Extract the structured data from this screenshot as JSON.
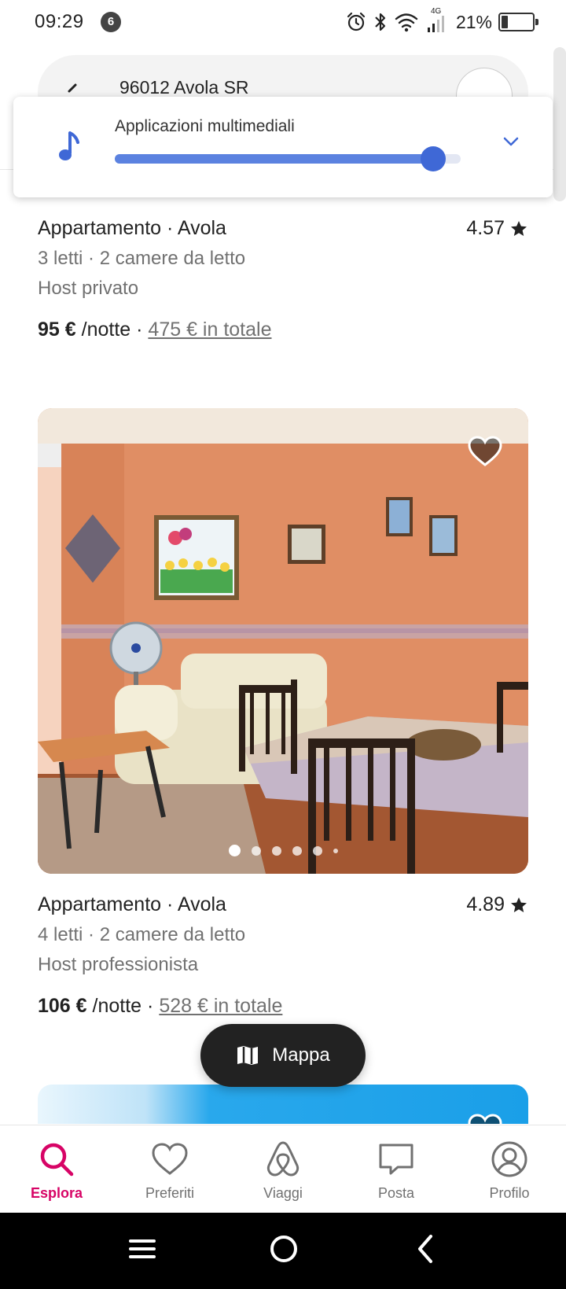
{
  "status_bar": {
    "time": "09:29",
    "notification_count": "6",
    "network_label": "4G",
    "battery_percent": "21%"
  },
  "search": {
    "location": "96012 Avola SR"
  },
  "volume_panel": {
    "label": "Applicazioni multimediali",
    "level": 0.92,
    "accent_color": "#3f68d6"
  },
  "listings": [
    {
      "title": "Appartamento · Avola",
      "rating": "4.57",
      "details": "3 letti · 2 camere da letto",
      "host": "Host privato",
      "price": "95 €",
      "per_night": "/notte",
      "separator": "·",
      "total": "475 € in totale"
    },
    {
      "title": "Appartamento · Avola",
      "rating": "4.89",
      "details": "4 letti · 2 camere da letto",
      "host": "Host professionista",
      "price": "106 €",
      "per_night": "/notte",
      "separator": "·",
      "total": "528 € in totale"
    }
  ],
  "map_button": {
    "label": "Mappa"
  },
  "bottom_nav": {
    "items": [
      {
        "label": "Esplora",
        "icon": "search-icon",
        "active": true
      },
      {
        "label": "Preferiti",
        "icon": "heart-icon",
        "active": false
      },
      {
        "label": "Viaggi",
        "icon": "airbnb-logo-icon",
        "active": false
      },
      {
        "label": "Posta",
        "icon": "message-icon",
        "active": false
      },
      {
        "label": "Profilo",
        "icon": "profile-icon",
        "active": false
      }
    ],
    "active_color": "#d70466"
  }
}
